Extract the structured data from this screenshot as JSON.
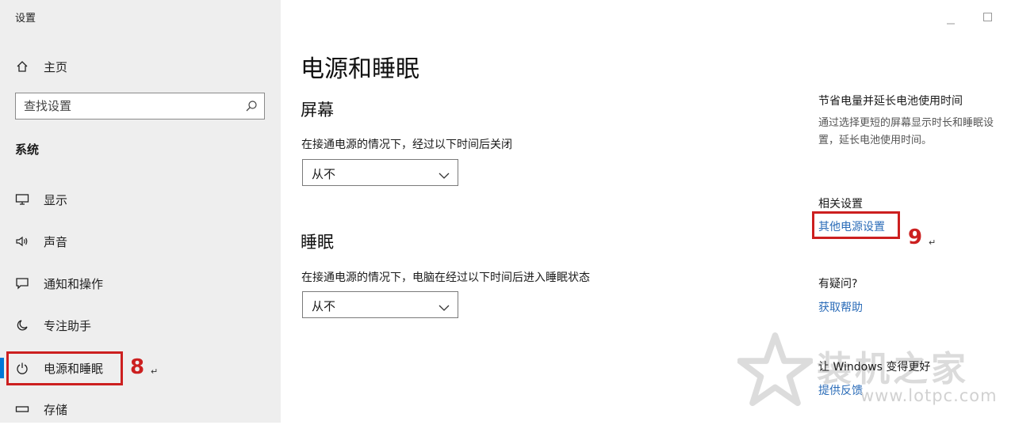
{
  "window": {
    "title": "设置"
  },
  "sidebar": {
    "home_label": "主页",
    "search_placeholder": "查找设置",
    "section_title": "系统",
    "items": [
      {
        "label": "显示",
        "icon": "monitor-icon"
      },
      {
        "label": "声音",
        "icon": "speaker-icon"
      },
      {
        "label": "通知和操作",
        "icon": "notification-icon"
      },
      {
        "label": "专注助手",
        "icon": "moon-icon"
      },
      {
        "label": "电源和睡眠",
        "icon": "power-icon",
        "active": true
      },
      {
        "label": "存储",
        "icon": "storage-icon"
      }
    ]
  },
  "main": {
    "title": "电源和睡眠",
    "screen": {
      "heading": "屏幕",
      "description": "在接通电源的情况下，经过以下时间后关闭",
      "value": "从不"
    },
    "sleep": {
      "heading": "睡眠",
      "description": "在接通电源的情况下，电脑在经过以下时间后进入睡眠状态",
      "value": "从不"
    }
  },
  "right_panel": {
    "tip_title": "节省电量并延长电池使用时间",
    "tip_text_line1": "通过选择更短的屏幕显示时长和睡眠设",
    "tip_text_line2": "置，延长电池使用时间。",
    "related_title": "相关设置",
    "related_link": "其他电源设置",
    "question_title": "有疑问?",
    "help_link": "获取帮助",
    "improve_title": "让 Windows 变得更好",
    "feedback_link": "提供反馈"
  },
  "annotations": {
    "step8": "8",
    "step9": "9",
    "mark": "↵"
  },
  "watermark": {
    "text": "装机之家",
    "url": "www.lotpc.com"
  },
  "colors": {
    "accent": "#0078d7",
    "annotation": "#cc1f1f",
    "link": "#2b6cb8",
    "sidebar_bg": "#eeeeee"
  }
}
